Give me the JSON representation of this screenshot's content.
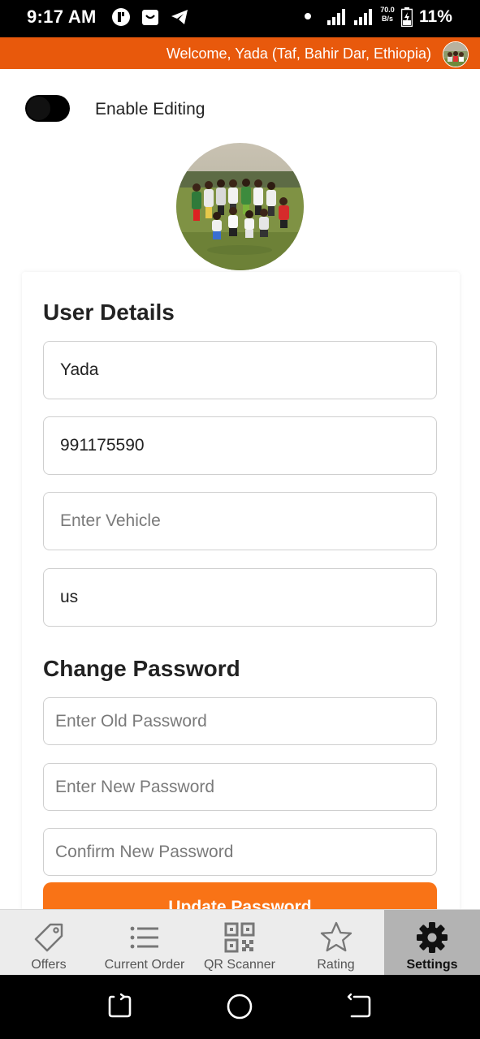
{
  "status_bar": {
    "time": "9:17 AM",
    "net_speed_value": "70.0",
    "net_speed_unit": "B/s",
    "battery_percent": "11%"
  },
  "header": {
    "welcome_text": "Welcome, Yada (Taf, Bahir Dar, Ethiopia)"
  },
  "editing": {
    "toggle_label": "Enable Editing",
    "enabled": false
  },
  "user_details": {
    "title": "User Details",
    "name_value": "Yada",
    "phone_value": "991175590",
    "vehicle_placeholder": "Enter Vehicle",
    "vehicle_value": "",
    "extra_value": "us"
  },
  "change_password": {
    "title": "Change Password",
    "old_placeholder": "Enter Old Password",
    "new_placeholder": "Enter New Password",
    "confirm_placeholder": "Confirm New Password",
    "button_label": "Update Password"
  },
  "bottom_nav": {
    "items": [
      {
        "label": "Offers",
        "icon": "tag-icon"
      },
      {
        "label": "Current Order",
        "icon": "list-icon"
      },
      {
        "label": "QR Scanner",
        "icon": "qr-code-icon"
      },
      {
        "label": "Rating",
        "icon": "star-icon"
      },
      {
        "label": "Settings",
        "icon": "gear-icon"
      }
    ],
    "active": "Settings"
  },
  "colors": {
    "accent": "#e8590c",
    "button": "#f97316",
    "nav_active_bg": "#b3b3b3"
  }
}
